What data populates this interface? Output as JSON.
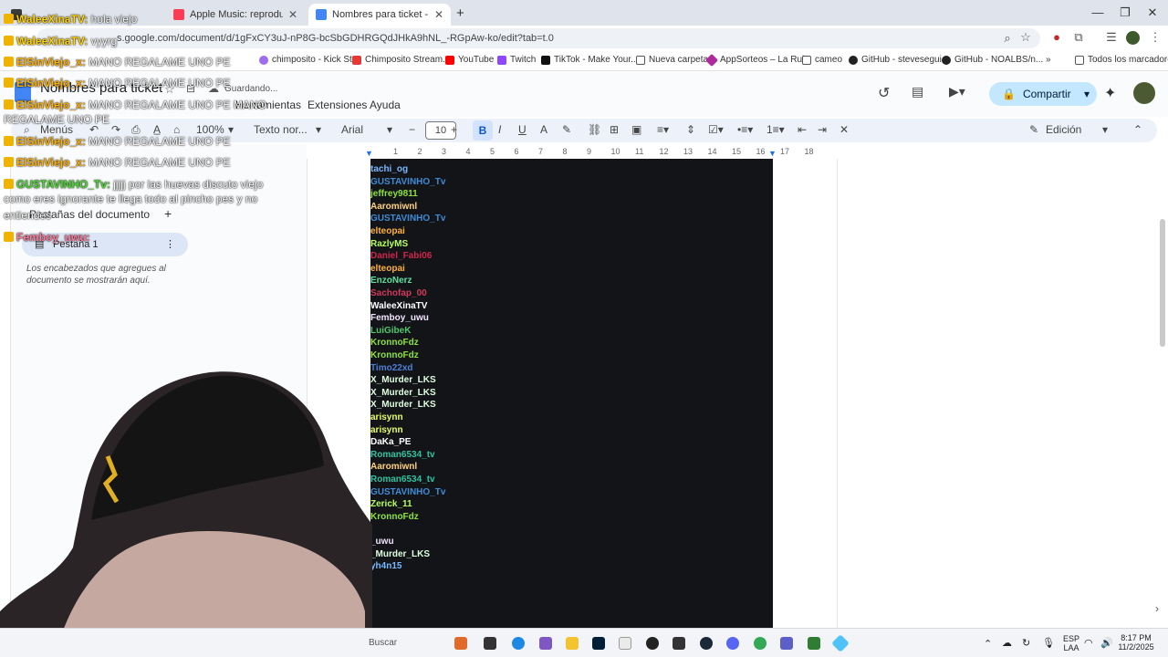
{
  "browser": {
    "tabs": [
      {
        "label": "",
        "active": false
      },
      {
        "label": "Apple Music: reproductor",
        "active": false
      },
      {
        "label": "Nombres para ticket - Docume",
        "active": true
      }
    ],
    "new_tab": "+",
    "url": "s.google.com/document/d/1gFxCY3uJ-nP8G-bcSbGDHRGQdJHkA9hNL_-RGpAw-ko/edit?tab=t.0",
    "bookmarks": [
      "chimposito - Kick St...",
      "Chimposito Stream...",
      "YouTube",
      "Twitch",
      "TikTok - Make Your...",
      "Nueva carpeta",
      "AppSorteos – La Rul...",
      "cameo",
      "GitHub - stevesegui...",
      "GitHub - NOALBS/n...",
      "Todos los marcadores"
    ]
  },
  "docs": {
    "title": "Nombres para ticket",
    "saving": "Guardando...",
    "menus": [
      "Herramientas",
      "Extensiones",
      "Ayuda"
    ],
    "share": "Compartir",
    "mode": "Edición",
    "toolbar": {
      "menus": "Menús",
      "zoom": "100%",
      "style": "Texto nor...",
      "font": "Arial",
      "size": "10"
    },
    "outline": {
      "heading": "Pestañas del documento",
      "tab": "Pestaña 1",
      "note": "Los encabezados que agregues al documento se mostrarán aquí."
    },
    "ruler": [
      "1",
      "2",
      "3",
      "4",
      "5",
      "6",
      "7",
      "8",
      "9",
      "10",
      "11",
      "12",
      "13",
      "14",
      "15",
      "16",
      "17",
      "18"
    ],
    "names": [
      {
        "text": "tachi_og",
        "color": "#7ab8ff"
      },
      {
        "text": "GUSTAVINHO_Tv",
        "color": "#3f8bd6"
      },
      {
        "text": "jeffrey9811",
        "color": "#8ee13c"
      },
      {
        "text": "Aaromiwnl",
        "color": "#ffd27a"
      },
      {
        "text": "GUSTAVINHO_Tv",
        "color": "#3f8bd6"
      },
      {
        "text": "elteopai",
        "color": "#ffb13b"
      },
      {
        "text": "RazlyMS",
        "color": "#b6ff5a"
      },
      {
        "text": "Daniel_Fabi06",
        "color": "#d0264c"
      },
      {
        "text": "elteopai",
        "color": "#ffb13b"
      },
      {
        "text": "EnzoNerz",
        "color": "#5ce1a0"
      },
      {
        "text": "Sachofap_00",
        "color": "#d13a5a"
      },
      {
        "text": "WaleeXinaTV",
        "color": "#ffffff"
      },
      {
        "text": "Femboy_uwu",
        "color": "#f4e4ff"
      },
      {
        "text": "LuiGibeK",
        "color": "#4fc76b"
      },
      {
        "text": "KronnoFdz",
        "color": "#8ee13c"
      },
      {
        "text": "KronnoFdz",
        "color": "#8ee13c"
      },
      {
        "text": "Timo22xd",
        "color": "#4c7fd6"
      },
      {
        "text": "X_Murder_LKS",
        "color": "#dfffe0"
      },
      {
        "text": "X_Murder_LKS",
        "color": "#dfffe0"
      },
      {
        "text": "X_Murder_LKS",
        "color": "#dfffe0"
      },
      {
        "text": "arisynn",
        "color": "#e8ff5a"
      },
      {
        "text": "arisynn",
        "color": "#e8ff5a"
      },
      {
        "text": "DaKa_PE",
        "color": "#ffffff"
      },
      {
        "text": "Roman6534_tv",
        "color": "#2ec4a0"
      },
      {
        "text": "Aaromiwnl",
        "color": "#ffd27a"
      },
      {
        "text": "Roman6534_tv",
        "color": "#2ec4a0"
      },
      {
        "text": "GUSTAVINHO_Tv",
        "color": "#3f8bd6"
      },
      {
        "text": "Zerick_11",
        "color": "#b6ff5a"
      },
      {
        "text": "KronnoFdz",
        "color": "#8ee13c"
      },
      {
        "text": "",
        "color": "#ffffff"
      },
      {
        "text": "_uwu",
        "color": "#f4e4ff"
      },
      {
        "text": "_Murder_LKS",
        "color": "#dfffe0"
      },
      {
        "text": "yh4n15",
        "color": "#7ab8ff"
      }
    ]
  },
  "chat": [
    {
      "user": "WaleeXinaTV:",
      "msg": "hola viejo",
      "color": "#ffd200"
    },
    {
      "user": "WaleeXinaTV:",
      "msg": "vyyrg",
      "color": "#ffd200"
    },
    {
      "user": "ElSinViejo_x:",
      "msg": "MANO REGALAME UNO PE",
      "color": "#ffb000"
    },
    {
      "user": "ElSinViejo_x:",
      "msg": "MANO REGALAME UNO PE",
      "color": "#ffb000"
    },
    {
      "user": "ElSinViejo_x:",
      "msg": "MANO REGALAME UNO PE MANO",
      "color": "#ffb000"
    },
    {
      "user": "",
      "msg": "REGALAME UNO PE",
      "color": "#ffb000"
    },
    {
      "user": "ElSinViejo_x:",
      "msg": "MANO REGALAME UNO PE",
      "color": "#ffb000"
    },
    {
      "user": "ElSinViejo_x:",
      "msg": "MANO REGALAME UNO PE",
      "color": "#ffb000"
    },
    {
      "user": "GUSTAVINHO_Tv:",
      "msg": "jjjjj por las huevas discuto viejo",
      "color": "#4cd630"
    },
    {
      "user": "",
      "msg": "como eres ignorante te llega todo al pincho pes y no",
      "color": "#4cd630"
    },
    {
      "user": "",
      "msg": "entiendes",
      "color": "#4cd630"
    },
    {
      "user": "Femboy_uwu:",
      "msg": "",
      "color": "#ff7b9c"
    }
  ],
  "taskbar": {
    "search": "Buscar",
    "lang": "ESP",
    "layout": "LAA",
    "time": "8:17 PM",
    "date": "11/2/2025"
  }
}
